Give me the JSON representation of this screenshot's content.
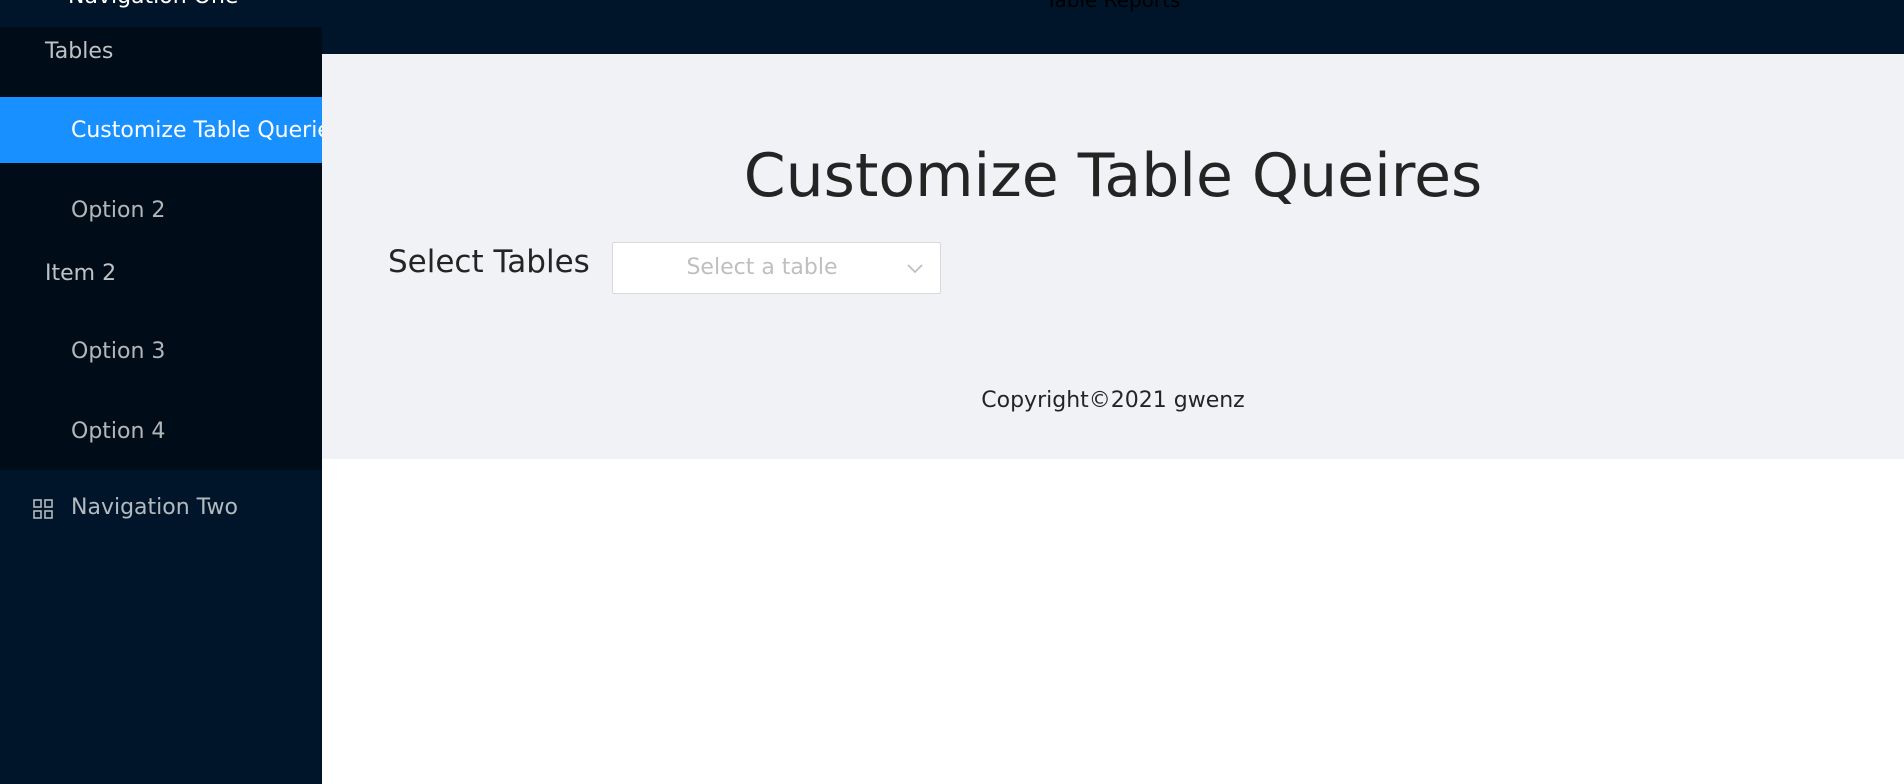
{
  "sidebar": {
    "brand": "Navigation One",
    "groups": [
      {
        "title": "Tables"
      },
      {
        "title": "Item 2"
      }
    ],
    "items": [
      {
        "label": "Customize Table Queries"
      },
      {
        "label": "Option 2"
      },
      {
        "label": "Option 3"
      },
      {
        "label": "Option 4"
      }
    ],
    "nav_two": {
      "label": "Navigation Two",
      "icon": "appstore-icon"
    }
  },
  "header": {
    "title": "Table Reports"
  },
  "main": {
    "title": "Customize Table Queires",
    "select_label": "Select Tables",
    "select_placeholder": "Select a table"
  },
  "footer": {
    "text": "Copyright©2021 gwenz"
  },
  "colors": {
    "sidebar_bg": "#001529",
    "submenu_bg": "#000c17",
    "accent": "#1890ff",
    "content_bg": "#f0f2f5"
  }
}
